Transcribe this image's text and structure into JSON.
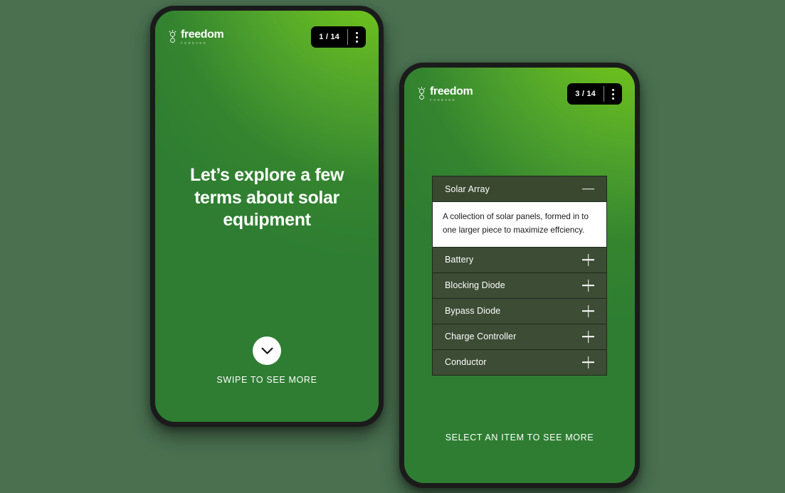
{
  "brand": {
    "name": "freedom",
    "trademark": "·",
    "tagline": "FOREVER",
    "mark_icon": "lightbulb-icon"
  },
  "phone_one": {
    "counter": "1 / 14",
    "menu_icon": "kebab-menu-icon",
    "heading": "Let’s explore a few terms about solar equipment",
    "swipe_icon": "chevron-down-icon",
    "swipe_label": "SWIPE TO SEE MORE"
  },
  "phone_two": {
    "counter": "3 / 14",
    "menu_icon": "kebab-menu-icon",
    "hint_label": "SELECT AN ITEM TO SEE MORE",
    "accordion": [
      {
        "label": "Solar Array",
        "expanded": true,
        "icon": "minus-icon",
        "body": "A collection of solar panels, formed in to one larger piece to maximize effciency."
      },
      {
        "label": "Battery",
        "expanded": false,
        "icon": "plus-icon",
        "body": ""
      },
      {
        "label": "Blocking Diode",
        "expanded": false,
        "icon": "plus-icon",
        "body": ""
      },
      {
        "label": "Bypass Diode",
        "expanded": false,
        "icon": "plus-icon",
        "body": ""
      },
      {
        "label": "Charge Controller",
        "expanded": false,
        "icon": "plus-icon",
        "body": ""
      },
      {
        "label": "Conductor",
        "expanded": false,
        "icon": "plus-icon",
        "body": ""
      }
    ]
  },
  "colors": {
    "page_background": "#4a7050",
    "screen_gradient_light": "#6cbf1d",
    "screen_gradient_dark": "#2e7d32",
    "accordion_item": "#3c4c35",
    "accordion_border": "#1f2a1c",
    "pill_background": "#000000",
    "text_on_green": "#ffffff",
    "body_text": "#1a1a1a"
  }
}
